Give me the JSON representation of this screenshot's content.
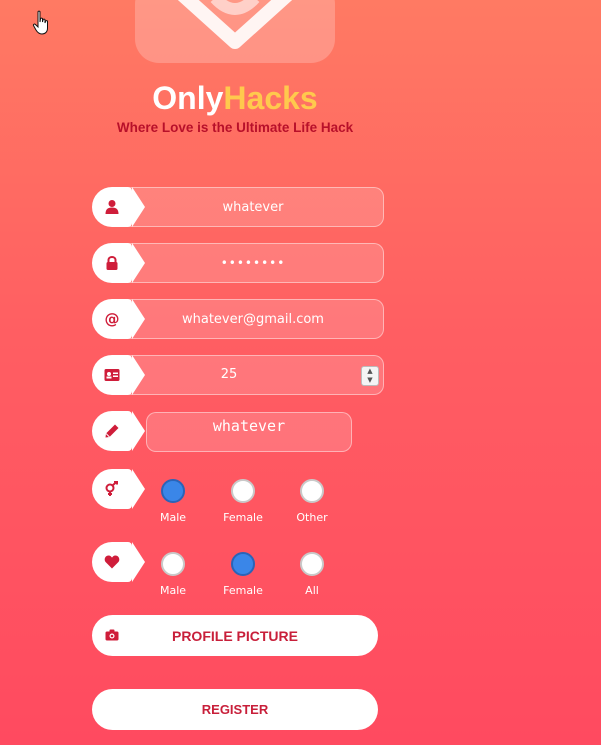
{
  "brand": {
    "name_part1": "Only",
    "name_part2": "Hacks",
    "tagline": "Where Love is the Ultimate Life Hack",
    "colors": {
      "accent": "#ffc94d",
      "primary_red": "#c81f3a"
    }
  },
  "form": {
    "username": {
      "value": "whatever",
      "icon": "user-icon"
    },
    "password": {
      "value": "••••••••",
      "icon": "lock-icon"
    },
    "email": {
      "value": "whatever@gmail.com",
      "icon": "at-icon"
    },
    "age": {
      "value": "25",
      "icon": "id-card-icon"
    },
    "bio": {
      "value": "whatever",
      "icon": "pencil-icon"
    },
    "gender": {
      "icon": "gender-icon",
      "options": [
        {
          "label": "Male",
          "checked": true
        },
        {
          "label": "Female",
          "checked": false
        },
        {
          "label": "Other",
          "checked": false
        }
      ]
    },
    "interest": {
      "icon": "heart-icon",
      "options": [
        {
          "label": "Male",
          "checked": false
        },
        {
          "label": "Female",
          "checked": true
        },
        {
          "label": "All",
          "checked": false
        }
      ]
    },
    "profile_picture_label": "PROFILE PICTURE",
    "register_label": "REGISTER"
  }
}
